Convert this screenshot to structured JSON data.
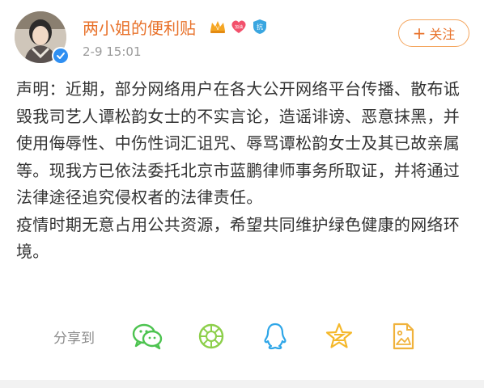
{
  "post": {
    "username": "两小姐的便利贴",
    "timestamp": "2-9 15:01",
    "follow_label": "关注",
    "follow_plus": "+",
    "badges": [
      {
        "name": "vip-crown-icon",
        "color": "#f5a623"
      },
      {
        "name": "heart-badge-icon",
        "color": "#f2506b",
        "text": "加油"
      },
      {
        "name": "shield-badge-icon",
        "color": "#3aa6e0",
        "text": "抗"
      }
    ],
    "content": {
      "paragraph1": "声明：近期，部分网络用户在各大公开网络平台传播、散布诋毁我司艺人谭松韵女士的不实言论，造谣诽谤、恶意抹黑，并使用侮辱性、中伤性词汇诅咒、辱骂谭松韵女士及其已故亲属等。现我方已依法委托北京市蓝鹏律师事务所取证，并将通过法律途径追究侵权者的法律责任。",
      "paragraph2": "疫情时期无意占用公共资源，希望共同维护绿色健康的网络环境。"
    }
  },
  "share": {
    "label": "分享到",
    "targets": [
      {
        "name": "wechat-icon",
        "color": "#4cc34f"
      },
      {
        "name": "moments-icon",
        "color": "#8ccf4a"
      },
      {
        "name": "qq-icon",
        "color": "#2ea6e8"
      },
      {
        "name": "qzone-icon",
        "color": "#f5b82a"
      },
      {
        "name": "save-image-icon",
        "color": "#f0b23c"
      }
    ]
  },
  "colors": {
    "accent": "#e8722b",
    "text": "#333333",
    "muted": "#9a9a9a"
  }
}
